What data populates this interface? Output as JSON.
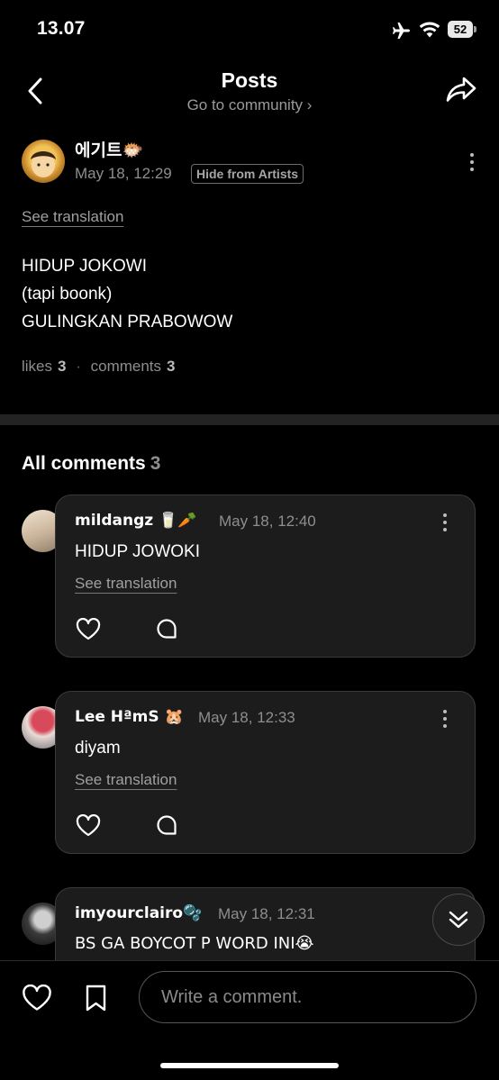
{
  "status_bar": {
    "time": "13.07",
    "battery": "52"
  },
  "header": {
    "title": "Posts",
    "subtitle": "Go to community ›"
  },
  "post": {
    "author": "에기트🐡",
    "time": "May 18, 12:29",
    "badge": "Hide from Artists",
    "see_translation": "See translation",
    "lines": [
      "HIDUP JOKOWI",
      "(tapi boonk)",
      "GULINGKAN PRABOWOW"
    ],
    "likes_label": "likes",
    "likes_count": "3",
    "separator": "·",
    "comments_label": "comments",
    "comments_count": "3"
  },
  "comments_section": {
    "title": "All comments",
    "count": "3"
  },
  "comments": [
    {
      "name": "mildangz 🥛🥕",
      "time": "May 18, 12:40",
      "text": "HIDUP JOWOKI",
      "see_translation": "See translation"
    },
    {
      "name": "Lee HªmS 🐹",
      "time": "May 18, 12:33",
      "text": "diyam",
      "see_translation": "See translation"
    },
    {
      "name": "imyourclairo🫧",
      "time": "May 18, 12:31",
      "text": "BS GA BOYCOT P WORD INI😭"
    }
  ],
  "bottom_bar": {
    "placeholder": "Write a comment."
  },
  "icons": {
    "back": "chevron-left-icon",
    "share": "share-arrow-icon",
    "more": "kebab-icon",
    "like": "heart-icon",
    "reply": "speech-bubble-icon",
    "bookmark": "bookmark-icon",
    "scroll": "double-chevron-down-icon"
  }
}
